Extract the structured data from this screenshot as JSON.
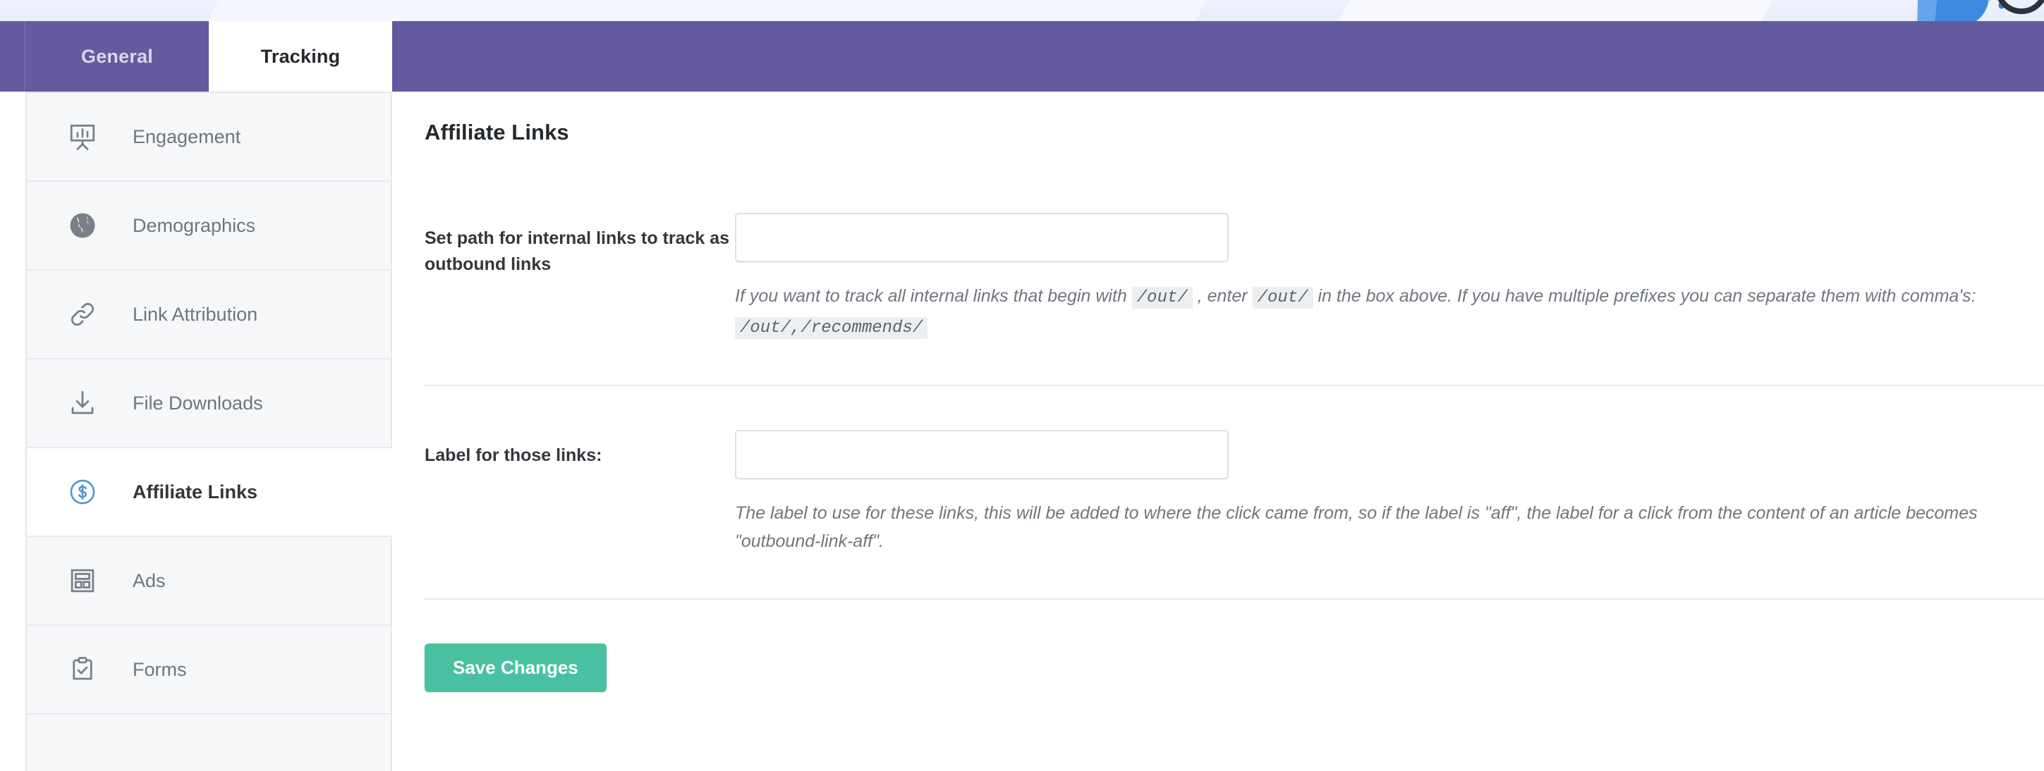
{
  "tabs": [
    {
      "label": "General",
      "active": false
    },
    {
      "label": "Tracking",
      "active": true
    }
  ],
  "sidebar": {
    "items": [
      {
        "label": "Engagement",
        "icon": "presentation-chart-icon",
        "active": false
      },
      {
        "label": "Demographics",
        "icon": "globe-icon",
        "active": false
      },
      {
        "label": "Link Attribution",
        "icon": "link-chain-icon",
        "active": false
      },
      {
        "label": "File Downloads",
        "icon": "download-icon",
        "active": false
      },
      {
        "label": "Affiliate Links",
        "icon": "dollar-circle-icon",
        "active": true
      },
      {
        "label": "Ads",
        "icon": "layout-grid-icon",
        "active": false
      },
      {
        "label": "Forms",
        "icon": "clipboard-check-icon",
        "active": false
      }
    ]
  },
  "main": {
    "title": "Affiliate Links",
    "fields": [
      {
        "label": "Set path for internal links to track as outbound links",
        "value": "",
        "placeholder": "",
        "helper_parts": [
          {
            "type": "text",
            "text": "If you want to track all internal links that begin with "
          },
          {
            "type": "code",
            "text": "/out/"
          },
          {
            "type": "text",
            "text": " , enter "
          },
          {
            "type": "code",
            "text": "/out/"
          },
          {
            "type": "text",
            "text": " in the box above. If you have multiple prefixes you can separate them with comma's: "
          },
          {
            "type": "code",
            "text": "/out/,/recommends/"
          }
        ]
      },
      {
        "label": "Label for those links:",
        "value": "",
        "placeholder": "",
        "helper_parts": [
          {
            "type": "text",
            "text": "The label to use for these links, this will be added to where the click came from, so if the label is \"aff\", the label for a click from the content of an article becomes \"outbound-link-aff\"."
          }
        ]
      }
    ],
    "save_label": "Save Changes"
  },
  "colors": {
    "header_purple": "#645a9f",
    "accent_green": "#49c1a1",
    "active_icon_blue": "#4f94d4",
    "sidebar_bg": "#f6f7f9"
  }
}
